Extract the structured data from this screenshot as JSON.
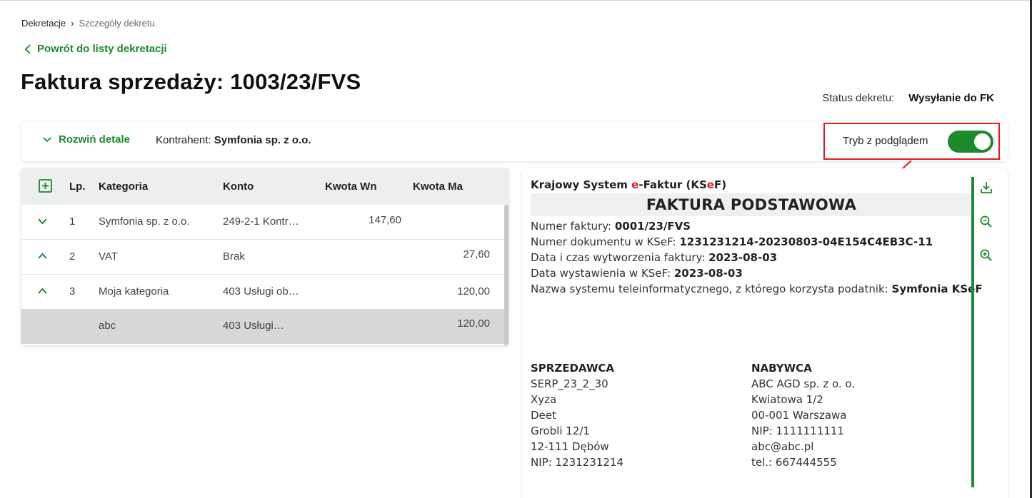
{
  "breadcrumb": {
    "root": "Dekretacje",
    "current": "Szczegóły dekretu"
  },
  "back_link": "Powrót do listy dekretacji",
  "page_title": "Faktura sprzedaży: 1003/23/FVS",
  "status": {
    "label": "Status dekretu:",
    "value": "Wysyłanie do FK"
  },
  "toolbar": {
    "expand_label": "Rozwiń detale",
    "contractor_label": "Kontrahent:",
    "contractor_value": "Symfonia sp. z o.o.",
    "preview_mode_label": "Tryb z podglądem",
    "preview_mode_on": true
  },
  "table": {
    "headers": {
      "lp": "Lp.",
      "category": "Kategoria",
      "account": "Konto",
      "debit": "Kwota Wn",
      "credit": "Kwota Ma"
    },
    "rows": [
      {
        "lp": "1",
        "category": "Symfonia sp. z o.o.",
        "account": "249-2-1 Kontr…",
        "debit": "147,60",
        "credit": "",
        "expanded": false
      },
      {
        "lp": "2",
        "category": "VAT",
        "account": "Brak",
        "debit": "",
        "credit": "27,60",
        "expanded": true
      },
      {
        "lp": "3",
        "category": "Moja kategoria",
        "account": "403 Usługi ob…",
        "debit": "",
        "credit": "120,00",
        "expanded": true
      },
      {
        "lp": "",
        "category": "abc",
        "account": "403 Usługi…",
        "debit": "",
        "credit": "120,00",
        "selected": true
      }
    ]
  },
  "invoice_preview": {
    "system_prefix": "Krajowy System ",
    "system_e": "e",
    "system_mid": "-Faktur (KS",
    "system_e2": "e",
    "system_suffix": "F)",
    "title": "FAKTURA PODSTAWOWA",
    "lines": [
      {
        "label": "Numer faktury: ",
        "value": "0001/23/FVS"
      },
      {
        "label": "Numer dokumentu w KSeF: ",
        "value": "1231231214-20230803-04E154C4EB3C-11"
      },
      {
        "label": "Data i czas wytworzenia faktury: ",
        "value": "2023-08-03"
      },
      {
        "label": "Data wystawienia w KSeF: ",
        "value": "2023-08-03"
      },
      {
        "label": "Nazwa systemu teleinformatycznego, z którego korzysta podatnik: ",
        "value": "Symfonia KSeF"
      }
    ],
    "seller": {
      "title": "SPRZEDAWCA",
      "lines": [
        "SERP_23_2_30",
        "Xyza",
        "Deet",
        "Grobli 12/1",
        "12-111 Dębów",
        "NIP: 1231231214"
      ]
    },
    "buyer": {
      "title": "NABYWCA",
      "lines": [
        "ABC AGD sp. z o. o.",
        "Kwiatowa 1/2",
        "00-001 Warszawa",
        "NIP: 1111111111",
        "abc@abc.pl",
        "tel.: 667444555"
      ]
    },
    "tools": [
      "download-icon",
      "zoom-out-icon",
      "zoom-in-icon"
    ]
  },
  "colors": {
    "accent": "#1d8a2e",
    "highlight": "#e21b1b",
    "selected_row": "#d7d7d7"
  }
}
